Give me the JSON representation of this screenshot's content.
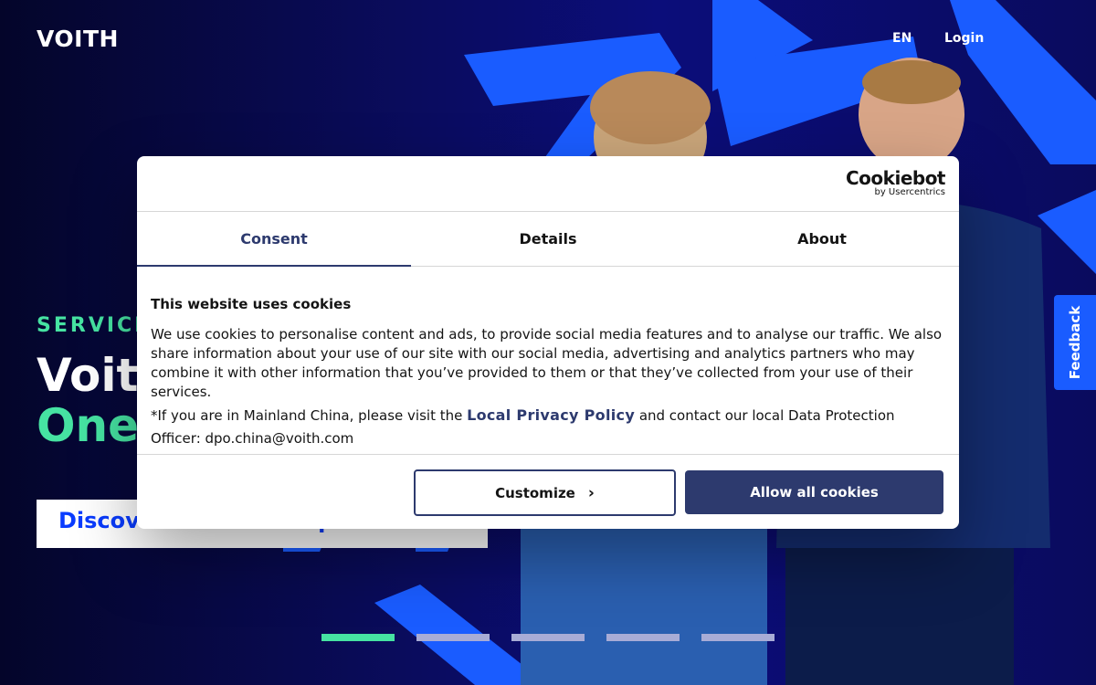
{
  "header": {
    "logo": "VOITH",
    "language": "EN",
    "login": "Login"
  },
  "hero": {
    "eyebrow": "SERVICE",
    "headline_line1": "Voith",
    "headline_line2": "One",
    "cta_label": "Discover our service portfolio",
    "cta_icon": "chevron-right-icon",
    "slides": {
      "count": 5,
      "active_index": 0
    },
    "colors": {
      "accent_green": "#46e3a2",
      "accent_blue": "#1a5cff",
      "background": "#0b0d7a"
    }
  },
  "feedback": {
    "label": "Feedback"
  },
  "cookie_dialog": {
    "brand": "Cookiebot",
    "brand_by": "by Usercentrics",
    "tabs": [
      {
        "label": "Consent",
        "active": true
      },
      {
        "label": "Details",
        "active": false
      },
      {
        "label": "About",
        "active": false
      }
    ],
    "heading": "This website uses cookies",
    "paragraph": "We use cookies to personalise content and ads, to provide social media features and to analyse our traffic. We also share information about your use of our site with our social media, advertising and analytics partners who may combine it with other information that you’ve provided to them or that they’ve collected from your use of their services.",
    "china_prefix": "*If you are in Mainland China, please visit the ",
    "china_link": "Local Privacy Policy",
    "china_suffix": " and contact our local Data Protection Officer: dpo.china@voith.com",
    "customize_label": "Customize",
    "allow_label": "Allow all cookies",
    "accent_color": "#2d3a6e"
  }
}
